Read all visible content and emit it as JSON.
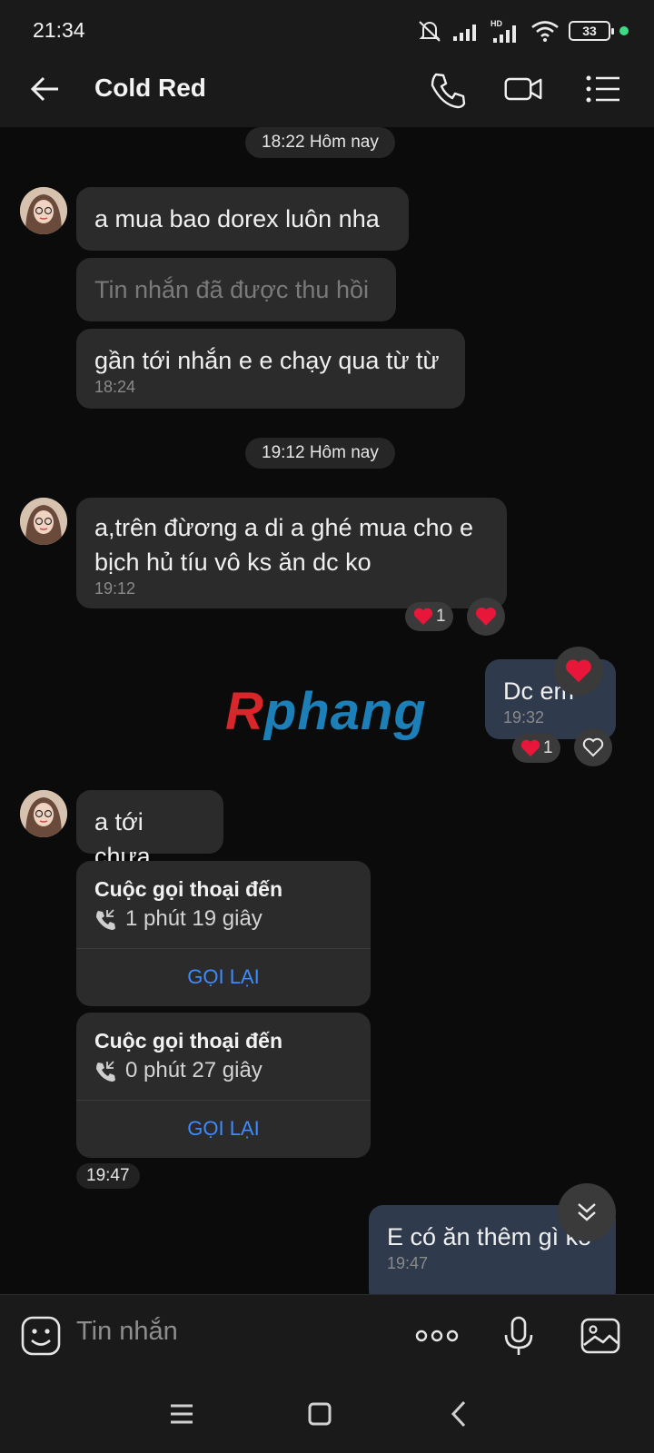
{
  "status_bar": {
    "time": "21:34",
    "battery": "33",
    "network_label": "HD"
  },
  "header": {
    "contact_name": "Cold Red"
  },
  "messages": {
    "date1": "18:22 Hôm nay",
    "m1": "a mua bao dorex luôn nha",
    "m2": "Tin nhắn đã được thu hồi",
    "m3": "gần tới nhắn e e chạy qua từ từ",
    "m3_time": "18:24",
    "date2": "19:12 Hôm nay",
    "m4_line1": "a,trên đừơng a di a ghé mua cho e",
    "m4_line2": "bịch hủ tíu vô ks ăn dc ko",
    "m4_time": "19:12",
    "m4_reaction_count": "1",
    "m5": "Dc em",
    "m5_time": "19:32",
    "m5_reaction_count": "1",
    "m6": "a tới chưa",
    "call1_title": "Cuộc gọi thoại đến",
    "call1_duration": "1 phút 19 giây",
    "call1_action": "GỌI LẠI",
    "call2_title": "Cuộc gọi thoại đến",
    "call2_duration": "0 phút 27 giây",
    "call2_action": "GỌI LẠI",
    "call_time": "19:47",
    "m7": "E có ăn thêm gì ko",
    "m7_time": "19:47"
  },
  "watermark": {
    "text_red": "R",
    "text_blue": "phang"
  },
  "composer": {
    "placeholder": "Tin nhắn"
  },
  "colors": {
    "accent_blue": "#3d8bfd",
    "bubble_incoming": "#2b2b2b",
    "bubble_outgoing": "#2f3a4d",
    "heart": "#e8173a",
    "background": "#0b0b0b"
  },
  "icons": [
    "back-arrow-icon",
    "phone-icon",
    "video-icon",
    "menu-list-icon",
    "heart-icon",
    "heart-outline-icon",
    "incoming-call-icon",
    "chevron-double-down-icon",
    "sticker-icon",
    "more-icon",
    "microphone-icon",
    "image-icon"
  ]
}
